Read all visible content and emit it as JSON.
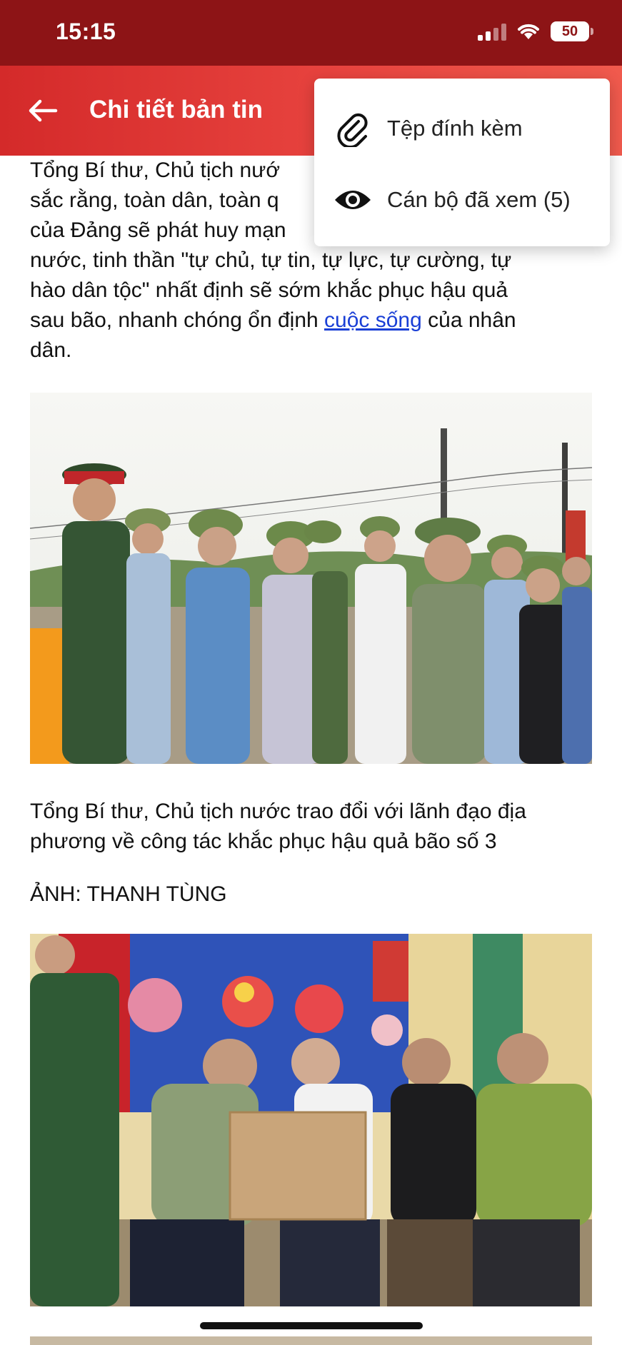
{
  "status_bar": {
    "time": "15:15",
    "battery": "50",
    "signal_bars": 2,
    "colors": {
      "bg": "#8d1416"
    }
  },
  "header": {
    "title": "Chi tiết bản tin",
    "back_icon": "arrow-left-icon",
    "colors": {
      "bg": "#e03a37"
    }
  },
  "menu": {
    "items": [
      {
        "icon": "paperclip-icon",
        "label": "Tệp đính kèm"
      },
      {
        "icon": "eye-icon",
        "label": "Cán bộ đã xem (5)"
      }
    ]
  },
  "article": {
    "paragraph_lines": [
      "Tổng Bí thư, Chủ tịch nướ",
      "sắc rằng, toàn dân, toàn q",
      "của Đảng sẽ phát huy mạn",
      "nước, tinh thần \"tự chủ, tự tin, tự lực, tự cường, tự",
      "hào dân tộc\" nhất định sẽ sớm khắc phục hậu quả",
      "sau bão, nhanh chóng ổn định"
    ],
    "link_text": "cuộc sống",
    "line6_suffix": " của nhân",
    "last_line": "dân.",
    "caption1_lines": [
      "Tổng Bí thư, Chủ tịch nước trao đổi với lãnh đạo địa",
      "phương về công tác khắc phục hậu quả bão số 3"
    ],
    "credit": "ẢNH: THANH TÙNG"
  }
}
